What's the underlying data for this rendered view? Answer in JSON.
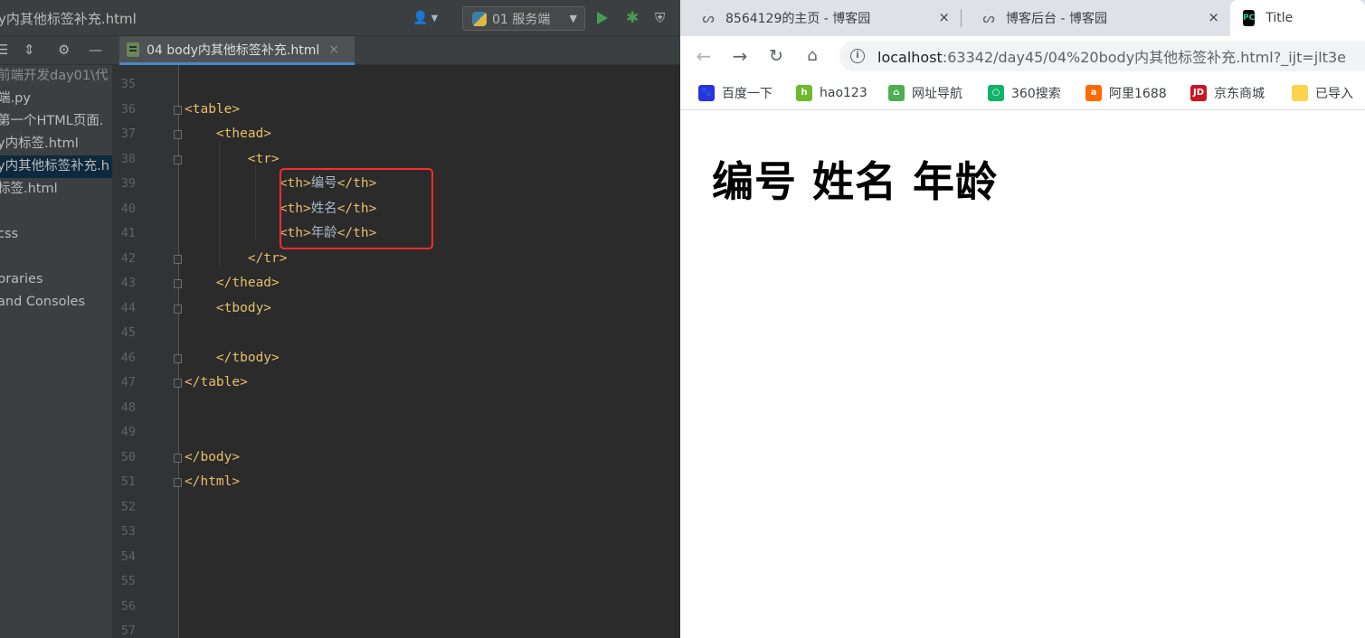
{
  "ide": {
    "window_title": "y内其他标签补充.html",
    "run_config": "01 服务端",
    "editor_tab": "04 body内其他标签补充.html",
    "tab_close": "×",
    "tree": [
      {
        "label": "前端开发day01\\代",
        "dim": true
      },
      {
        "label": "端.py",
        "dim": false
      },
      {
        "label": "第一个HTML页面.",
        "dim": false
      },
      {
        "label": "y内标签.html",
        "dim": false
      },
      {
        "label": "y内其他标签补充.h",
        "dim": false,
        "selected": true
      },
      {
        "label": "标签.html",
        "dim": false
      },
      {
        "label": "",
        "dim": false
      },
      {
        "label": "css",
        "dim": false
      },
      {
        "label": "",
        "dim": false
      },
      {
        "label": "braries",
        "dim": false
      },
      {
        "label": "and Consoles",
        "dim": false
      }
    ],
    "lines": [
      {
        "num": "35",
        "code": ""
      },
      {
        "num": "36",
        "code": "<table>",
        "fold": true
      },
      {
        "num": "37",
        "code": "    <thead>",
        "fold": true
      },
      {
        "num": "38",
        "code": "        <tr>",
        "fold": true
      },
      {
        "num": "39",
        "code": "            <th>",
        "text": "编号",
        "close": "</th>"
      },
      {
        "num": "40",
        "code": "            <th>",
        "text": "姓名",
        "close": "</th>"
      },
      {
        "num": "41",
        "code": "            <th>",
        "text": "年龄",
        "close": "</th>"
      },
      {
        "num": "42",
        "code": "        </tr>",
        "fold": true
      },
      {
        "num": "43",
        "code": "    </thead>",
        "fold": true
      },
      {
        "num": "44",
        "code": "    <tbody>",
        "fold": true
      },
      {
        "num": "45",
        "code": ""
      },
      {
        "num": "46",
        "code": "    </tbody>",
        "fold": true
      },
      {
        "num": "47",
        "code": "</table>",
        "fold": true
      },
      {
        "num": "48",
        "code": ""
      },
      {
        "num": "49",
        "code": ""
      },
      {
        "num": "50",
        "code": "</body>",
        "fold": true
      },
      {
        "num": "51",
        "code": "</html>",
        "fold": true
      },
      {
        "num": "52",
        "code": ""
      },
      {
        "num": "53",
        "code": ""
      },
      {
        "num": "54",
        "code": ""
      },
      {
        "num": "55",
        "code": ""
      },
      {
        "num": "56",
        "code": ""
      },
      {
        "num": "57",
        "code": ""
      }
    ]
  },
  "browser": {
    "tabs": [
      {
        "title": "8564129的主页 - 博客园",
        "close": "×"
      },
      {
        "title": "博客后台 - 博客园",
        "close": "×"
      },
      {
        "title": "Title"
      }
    ],
    "pycharm_favicon": "PC",
    "url_host": "localhost",
    "url_rest": ":63342/day45/04%20body内其他标签补充.html?_ijt=jlt3e",
    "bookmarks": [
      {
        "label": "百度一下",
        "icon": "🐾",
        "color": "#2932e1"
      },
      {
        "label": "hao123",
        "icon": "h",
        "color": "#6fb92c"
      },
      {
        "label": "网址导航",
        "icon": "⌂",
        "color": "#4caf50"
      },
      {
        "label": "360搜索",
        "icon": "○",
        "color": "#11b36b"
      },
      {
        "label": "阿里1688",
        "icon": "a",
        "color": "#ff6a00"
      },
      {
        "label": "京东商城",
        "icon": "JD",
        "color": "#c91623"
      },
      {
        "label": "已导入",
        "icon": "",
        "color": "#fcd34d"
      }
    ],
    "page_heading": "编号 姓名 年龄"
  },
  "colors": {
    "ide_bg": "#2b2b2b",
    "tag_color": "#e8bf6a",
    "highlight": "#ff2a2a"
  }
}
